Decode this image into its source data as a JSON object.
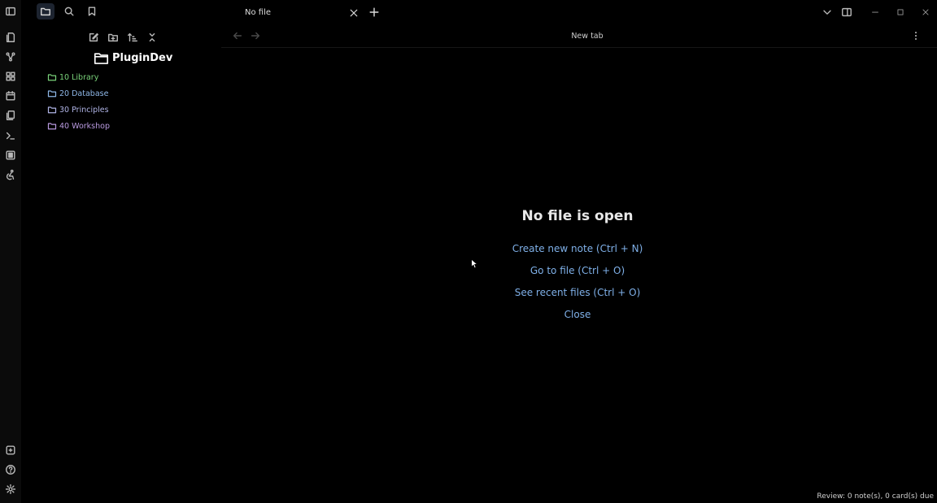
{
  "sidebar": {
    "vault_name": "PluginDev",
    "folders": [
      {
        "label": "10 Library",
        "color": "#7ad37a"
      },
      {
        "label": "20 Database",
        "color": "#8fb8e8"
      },
      {
        "label": "30 Principles",
        "color": "#b0b4e6"
      },
      {
        "label": "40 Workshop",
        "color": "#b99ae0"
      }
    ]
  },
  "tabs": [
    {
      "title": "No file",
      "active": true
    }
  ],
  "view": {
    "title": "New tab"
  },
  "empty_state": {
    "title": "No file is open",
    "actions": [
      "Create new note (Ctrl + N)",
      "Go to file (Ctrl + O)",
      "See recent files (Ctrl + O)",
      "Close"
    ]
  },
  "status_bar": {
    "review": "Review: 0 note(s), 0 card(s) due"
  },
  "colors": {
    "background": "#000000",
    "link": "#7fb0e8",
    "accent_active": "#1d2430"
  }
}
